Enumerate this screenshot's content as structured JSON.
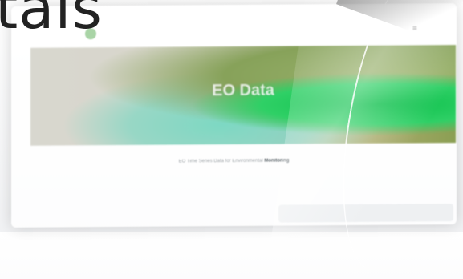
{
  "overlay": {
    "big_text": "tals"
  },
  "site": {
    "logo": {
      "line1": "",
      "line2": ""
    },
    "nav": {
      "items": [
        "",
        "",
        "",
        "",
        "",
        "",
        "",
        "",
        ""
      ],
      "menu_icon": "menu-icon"
    },
    "hero": {
      "title": "EO Data"
    },
    "tagline": {
      "text": "EO Time Series Data for Environmental",
      "emphasis": "Monitoring"
    },
    "description": ""
  }
}
